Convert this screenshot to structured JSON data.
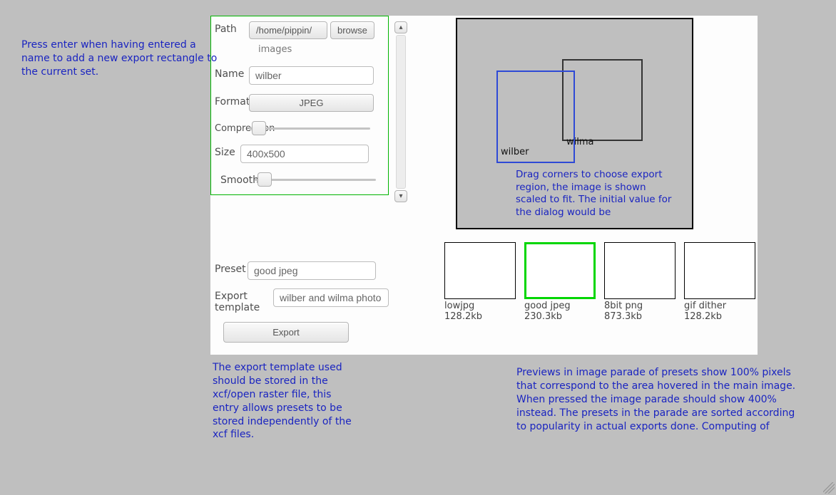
{
  "form": {
    "path": {
      "label": "Path",
      "value": "/home/pippin/",
      "sub": "images",
      "browse": "browse"
    },
    "name": {
      "label": "Name",
      "value": "wilber"
    },
    "format": {
      "label": "Format",
      "value": "JPEG"
    },
    "compression": {
      "label": "Compression"
    },
    "size": {
      "label": "Size",
      "value": "400x500"
    },
    "smooth": {
      "label": "Smooth"
    },
    "preset": {
      "label": "Preset",
      "value": "good jpeg"
    },
    "template": {
      "label": "Export template",
      "value": "wilber and wilma photo"
    },
    "export_btn": "Export"
  },
  "regions": {
    "wilber": "wilber",
    "wilma": "wilma"
  },
  "canvas_note": "Drag corners to choose export region, the image is shown scaled to fit. The initial value for the dialog would be",
  "presets": [
    {
      "name": "lowjpg",
      "size": "128.2kb",
      "active": false
    },
    {
      "name": "good jpeg",
      "size": "230.3kb",
      "active": true
    },
    {
      "name": "8bit png",
      "size": "873.3kb",
      "active": false
    },
    {
      "name": "gif dither",
      "size": "128.2kb",
      "active": false
    }
  ],
  "notes": {
    "left_top": "Press enter when having entered a name to add a new export rectangle to the current set.",
    "left_bot": "The export template used should be stored in the xcf/open raster file, this entry allows presets to be stored independently of the xcf files.",
    "right_bot": "Previews in image parade of presets show 100% pixels that correspond to the area hovered in the main image. When pressed the image parade should show 400% instead. The presets in the parade are sorted according to popularity in actual exports done. Computing of"
  }
}
